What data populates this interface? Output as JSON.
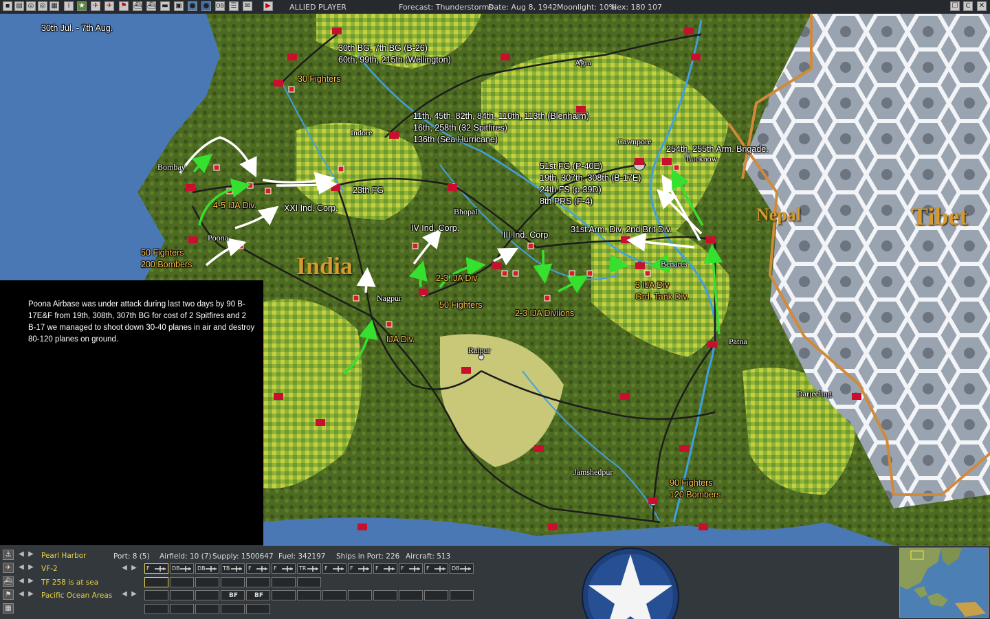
{
  "toolbar": {
    "player": "ALLIED PLAYER",
    "forecast": "Forecast: Thunderstorms",
    "date": "Date: Aug 8, 1942",
    "moonlight": "Moonlight: 10%",
    "hex": "Hex: 180 107",
    "right_buttons": [
      "☐",
      "C",
      "✕"
    ]
  },
  "map": {
    "period": "30th Jul. - 7th Aug.",
    "regions": [
      "India",
      "Nepal",
      "Tibet"
    ],
    "cities": [
      "Bombay",
      "Poona",
      "Indore",
      "Bhopal",
      "Agra",
      "Cawnpore",
      "Lucknow",
      "Benares",
      "Nagpur",
      "Raipur",
      "Patna",
      "Darjeeling",
      "Jamshedpur"
    ],
    "white_labels": [
      "30th BG, 7th BG (B-26)",
      "60th, 99th, 215th (Wellington)",
      "11th, 45th, 82th, 84th, 110th, 113th (Blenhaim)",
      "16th, 258th (32 Spitfires)",
      "136th (Sea Hurricane)",
      "254th, 255th Arm. Brigade.",
      "51st FG (P-40E)",
      "19th, 307th, 308th (B-17E)",
      "24th FS (p-39D)",
      "8th PRS (F-4)",
      "23th FG",
      "XXI Ind. Corp.",
      "IV Ind. Corp.",
      "III Ind. Corp",
      "31st Arm. Div, 2nd Brit Div."
    ],
    "orange_labels": [
      "30 Fighters",
      "4-5 IJA Div.",
      "50 Fighters",
      "200 Bombers",
      "2-3 IJA Div",
      "50 Fighters",
      "2-3 IJA Diviions",
      "3 IJA Div",
      "Grd. Tank Div.",
      "IJA Div.",
      "90 Fighters",
      "120 Bombers"
    ],
    "note": "Poona Airbase was under attack during last two days by 90 B-17E&F from 19th, 308th, 307th BG for cost of 2 Spitfires and 2 B-17 we managed to shoot down 30-40 planes in air and destroy 80-120 planes on ground."
  },
  "bottom": {
    "rows": [
      "Pearl Harbor",
      "VF-2",
      "TF 258 is at sea",
      "Pacific Ocean Areas"
    ],
    "stats": {
      "port": "Port: 8 (5)",
      "airfield": "Airfield: 10 (7)",
      "supply": "Supply: 1500647",
      "fuel": "Fuel: 342197",
      "ships": "Ships in Port: 226",
      "aircraft": "Aircraft: 513"
    },
    "air_slots": [
      "F",
      "DB",
      "DB",
      "TB",
      "F",
      "F",
      "TR",
      "F",
      "F",
      "F",
      "F",
      "F",
      "F",
      "F",
      "DB"
    ],
    "action_slots": [
      "BF",
      "BF"
    ]
  },
  "colors": {
    "panel": "#33383c",
    "accent_yellow": "#e8d24a",
    "label_orange": "#ffc34a",
    "region_gold": "#d79a2c",
    "arrow_green": "#35e02e",
    "sea_blue": "#4a78b4"
  }
}
